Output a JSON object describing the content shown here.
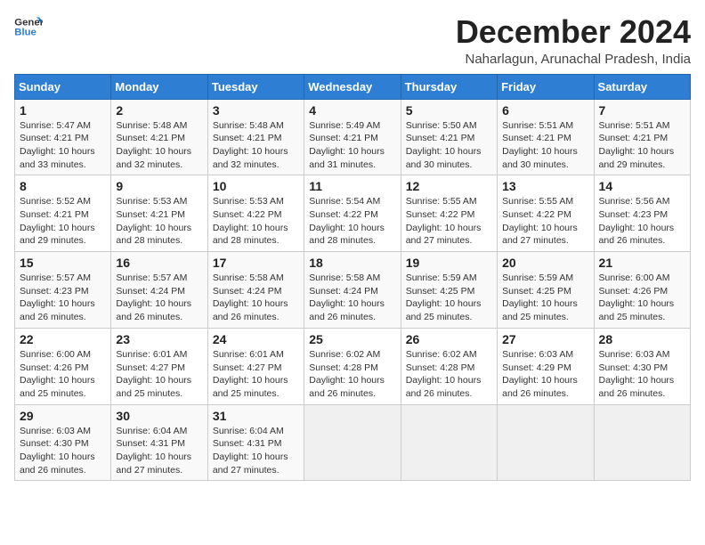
{
  "logo": {
    "line1": "General",
    "line2": "Blue"
  },
  "title": "December 2024",
  "subtitle": "Naharlagun, Arunachal Pradesh, India",
  "weekdays": [
    "Sunday",
    "Monday",
    "Tuesday",
    "Wednesday",
    "Thursday",
    "Friday",
    "Saturday"
  ],
  "weeks": [
    [
      {
        "day": "1",
        "detail": "Sunrise: 5:47 AM\nSunset: 4:21 PM\nDaylight: 10 hours\nand 33 minutes."
      },
      {
        "day": "2",
        "detail": "Sunrise: 5:48 AM\nSunset: 4:21 PM\nDaylight: 10 hours\nand 32 minutes."
      },
      {
        "day": "3",
        "detail": "Sunrise: 5:48 AM\nSunset: 4:21 PM\nDaylight: 10 hours\nand 32 minutes."
      },
      {
        "day": "4",
        "detail": "Sunrise: 5:49 AM\nSunset: 4:21 PM\nDaylight: 10 hours\nand 31 minutes."
      },
      {
        "day": "5",
        "detail": "Sunrise: 5:50 AM\nSunset: 4:21 PM\nDaylight: 10 hours\nand 30 minutes."
      },
      {
        "day": "6",
        "detail": "Sunrise: 5:51 AM\nSunset: 4:21 PM\nDaylight: 10 hours\nand 30 minutes."
      },
      {
        "day": "7",
        "detail": "Sunrise: 5:51 AM\nSunset: 4:21 PM\nDaylight: 10 hours\nand 29 minutes."
      }
    ],
    [
      {
        "day": "8",
        "detail": "Sunrise: 5:52 AM\nSunset: 4:21 PM\nDaylight: 10 hours\nand 29 minutes."
      },
      {
        "day": "9",
        "detail": "Sunrise: 5:53 AM\nSunset: 4:21 PM\nDaylight: 10 hours\nand 28 minutes."
      },
      {
        "day": "10",
        "detail": "Sunrise: 5:53 AM\nSunset: 4:22 PM\nDaylight: 10 hours\nand 28 minutes."
      },
      {
        "day": "11",
        "detail": "Sunrise: 5:54 AM\nSunset: 4:22 PM\nDaylight: 10 hours\nand 28 minutes."
      },
      {
        "day": "12",
        "detail": "Sunrise: 5:55 AM\nSunset: 4:22 PM\nDaylight: 10 hours\nand 27 minutes."
      },
      {
        "day": "13",
        "detail": "Sunrise: 5:55 AM\nSunset: 4:22 PM\nDaylight: 10 hours\nand 27 minutes."
      },
      {
        "day": "14",
        "detail": "Sunrise: 5:56 AM\nSunset: 4:23 PM\nDaylight: 10 hours\nand 26 minutes."
      }
    ],
    [
      {
        "day": "15",
        "detail": "Sunrise: 5:57 AM\nSunset: 4:23 PM\nDaylight: 10 hours\nand 26 minutes."
      },
      {
        "day": "16",
        "detail": "Sunrise: 5:57 AM\nSunset: 4:24 PM\nDaylight: 10 hours\nand 26 minutes."
      },
      {
        "day": "17",
        "detail": "Sunrise: 5:58 AM\nSunset: 4:24 PM\nDaylight: 10 hours\nand 26 minutes."
      },
      {
        "day": "18",
        "detail": "Sunrise: 5:58 AM\nSunset: 4:24 PM\nDaylight: 10 hours\nand 26 minutes."
      },
      {
        "day": "19",
        "detail": "Sunrise: 5:59 AM\nSunset: 4:25 PM\nDaylight: 10 hours\nand 25 minutes."
      },
      {
        "day": "20",
        "detail": "Sunrise: 5:59 AM\nSunset: 4:25 PM\nDaylight: 10 hours\nand 25 minutes."
      },
      {
        "day": "21",
        "detail": "Sunrise: 6:00 AM\nSunset: 4:26 PM\nDaylight: 10 hours\nand 25 minutes."
      }
    ],
    [
      {
        "day": "22",
        "detail": "Sunrise: 6:00 AM\nSunset: 4:26 PM\nDaylight: 10 hours\nand 25 minutes."
      },
      {
        "day": "23",
        "detail": "Sunrise: 6:01 AM\nSunset: 4:27 PM\nDaylight: 10 hours\nand 25 minutes."
      },
      {
        "day": "24",
        "detail": "Sunrise: 6:01 AM\nSunset: 4:27 PM\nDaylight: 10 hours\nand 25 minutes."
      },
      {
        "day": "25",
        "detail": "Sunrise: 6:02 AM\nSunset: 4:28 PM\nDaylight: 10 hours\nand 26 minutes."
      },
      {
        "day": "26",
        "detail": "Sunrise: 6:02 AM\nSunset: 4:28 PM\nDaylight: 10 hours\nand 26 minutes."
      },
      {
        "day": "27",
        "detail": "Sunrise: 6:03 AM\nSunset: 4:29 PM\nDaylight: 10 hours\nand 26 minutes."
      },
      {
        "day": "28",
        "detail": "Sunrise: 6:03 AM\nSunset: 4:30 PM\nDaylight: 10 hours\nand 26 minutes."
      }
    ],
    [
      {
        "day": "29",
        "detail": "Sunrise: 6:03 AM\nSunset: 4:30 PM\nDaylight: 10 hours\nand 26 minutes."
      },
      {
        "day": "30",
        "detail": "Sunrise: 6:04 AM\nSunset: 4:31 PM\nDaylight: 10 hours\nand 27 minutes."
      },
      {
        "day": "31",
        "detail": "Sunrise: 6:04 AM\nSunset: 4:31 PM\nDaylight: 10 hours\nand 27 minutes."
      },
      {
        "day": "",
        "detail": ""
      },
      {
        "day": "",
        "detail": ""
      },
      {
        "day": "",
        "detail": ""
      },
      {
        "day": "",
        "detail": ""
      }
    ]
  ]
}
